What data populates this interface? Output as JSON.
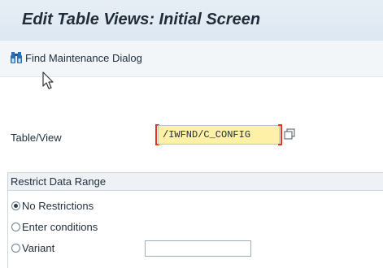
{
  "window": {
    "title": "Edit Table Views: Initial Screen"
  },
  "toolbar": {
    "find_button_label": "Find Maintenance Dialog",
    "find_button_icon": "binoculars-icon"
  },
  "form": {
    "table_view_label": "Table/View",
    "table_view_value": "/IWFND/C_CONFIG"
  },
  "restrict_group": {
    "title": "Restrict Data Range",
    "options": [
      {
        "label": "No Restrictions",
        "selected": true
      },
      {
        "label": "Enter conditions",
        "selected": false
      },
      {
        "label": "Variant",
        "selected": false
      }
    ],
    "variant_value": ""
  },
  "colors": {
    "title_bar": "#dde7f1",
    "input_focus_bg": "#fff0a8",
    "required_bracket": "#e8341c",
    "icon_blue": "#2a6fb5"
  }
}
